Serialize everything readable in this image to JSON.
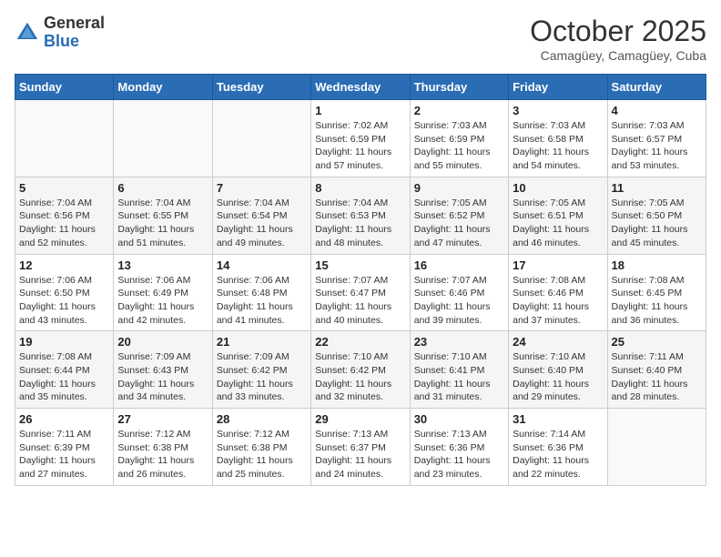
{
  "logo": {
    "general": "General",
    "blue": "Blue"
  },
  "title": "October 2025",
  "subtitle": "Camagüey, Camagüey, Cuba",
  "days_header": [
    "Sunday",
    "Monday",
    "Tuesday",
    "Wednesday",
    "Thursday",
    "Friday",
    "Saturday"
  ],
  "weeks": [
    [
      {
        "day": "",
        "info": ""
      },
      {
        "day": "",
        "info": ""
      },
      {
        "day": "",
        "info": ""
      },
      {
        "day": "1",
        "info": "Sunrise: 7:02 AM\nSunset: 6:59 PM\nDaylight: 11 hours and 57 minutes."
      },
      {
        "day": "2",
        "info": "Sunrise: 7:03 AM\nSunset: 6:59 PM\nDaylight: 11 hours and 55 minutes."
      },
      {
        "day": "3",
        "info": "Sunrise: 7:03 AM\nSunset: 6:58 PM\nDaylight: 11 hours and 54 minutes."
      },
      {
        "day": "4",
        "info": "Sunrise: 7:03 AM\nSunset: 6:57 PM\nDaylight: 11 hours and 53 minutes."
      }
    ],
    [
      {
        "day": "5",
        "info": "Sunrise: 7:04 AM\nSunset: 6:56 PM\nDaylight: 11 hours and 52 minutes."
      },
      {
        "day": "6",
        "info": "Sunrise: 7:04 AM\nSunset: 6:55 PM\nDaylight: 11 hours and 51 minutes."
      },
      {
        "day": "7",
        "info": "Sunrise: 7:04 AM\nSunset: 6:54 PM\nDaylight: 11 hours and 49 minutes."
      },
      {
        "day": "8",
        "info": "Sunrise: 7:04 AM\nSunset: 6:53 PM\nDaylight: 11 hours and 48 minutes."
      },
      {
        "day": "9",
        "info": "Sunrise: 7:05 AM\nSunset: 6:52 PM\nDaylight: 11 hours and 47 minutes."
      },
      {
        "day": "10",
        "info": "Sunrise: 7:05 AM\nSunset: 6:51 PM\nDaylight: 11 hours and 46 minutes."
      },
      {
        "day": "11",
        "info": "Sunrise: 7:05 AM\nSunset: 6:50 PM\nDaylight: 11 hours and 45 minutes."
      }
    ],
    [
      {
        "day": "12",
        "info": "Sunrise: 7:06 AM\nSunset: 6:50 PM\nDaylight: 11 hours and 43 minutes."
      },
      {
        "day": "13",
        "info": "Sunrise: 7:06 AM\nSunset: 6:49 PM\nDaylight: 11 hours and 42 minutes."
      },
      {
        "day": "14",
        "info": "Sunrise: 7:06 AM\nSunset: 6:48 PM\nDaylight: 11 hours and 41 minutes."
      },
      {
        "day": "15",
        "info": "Sunrise: 7:07 AM\nSunset: 6:47 PM\nDaylight: 11 hours and 40 minutes."
      },
      {
        "day": "16",
        "info": "Sunrise: 7:07 AM\nSunset: 6:46 PM\nDaylight: 11 hours and 39 minutes."
      },
      {
        "day": "17",
        "info": "Sunrise: 7:08 AM\nSunset: 6:46 PM\nDaylight: 11 hours and 37 minutes."
      },
      {
        "day": "18",
        "info": "Sunrise: 7:08 AM\nSunset: 6:45 PM\nDaylight: 11 hours and 36 minutes."
      }
    ],
    [
      {
        "day": "19",
        "info": "Sunrise: 7:08 AM\nSunset: 6:44 PM\nDaylight: 11 hours and 35 minutes."
      },
      {
        "day": "20",
        "info": "Sunrise: 7:09 AM\nSunset: 6:43 PM\nDaylight: 11 hours and 34 minutes."
      },
      {
        "day": "21",
        "info": "Sunrise: 7:09 AM\nSunset: 6:42 PM\nDaylight: 11 hours and 33 minutes."
      },
      {
        "day": "22",
        "info": "Sunrise: 7:10 AM\nSunset: 6:42 PM\nDaylight: 11 hours and 32 minutes."
      },
      {
        "day": "23",
        "info": "Sunrise: 7:10 AM\nSunset: 6:41 PM\nDaylight: 11 hours and 31 minutes."
      },
      {
        "day": "24",
        "info": "Sunrise: 7:10 AM\nSunset: 6:40 PM\nDaylight: 11 hours and 29 minutes."
      },
      {
        "day": "25",
        "info": "Sunrise: 7:11 AM\nSunset: 6:40 PM\nDaylight: 11 hours and 28 minutes."
      }
    ],
    [
      {
        "day": "26",
        "info": "Sunrise: 7:11 AM\nSunset: 6:39 PM\nDaylight: 11 hours and 27 minutes."
      },
      {
        "day": "27",
        "info": "Sunrise: 7:12 AM\nSunset: 6:38 PM\nDaylight: 11 hours and 26 minutes."
      },
      {
        "day": "28",
        "info": "Sunrise: 7:12 AM\nSunset: 6:38 PM\nDaylight: 11 hours and 25 minutes."
      },
      {
        "day": "29",
        "info": "Sunrise: 7:13 AM\nSunset: 6:37 PM\nDaylight: 11 hours and 24 minutes."
      },
      {
        "day": "30",
        "info": "Sunrise: 7:13 AM\nSunset: 6:36 PM\nDaylight: 11 hours and 23 minutes."
      },
      {
        "day": "31",
        "info": "Sunrise: 7:14 AM\nSunset: 6:36 PM\nDaylight: 11 hours and 22 minutes."
      },
      {
        "day": "",
        "info": ""
      }
    ]
  ]
}
